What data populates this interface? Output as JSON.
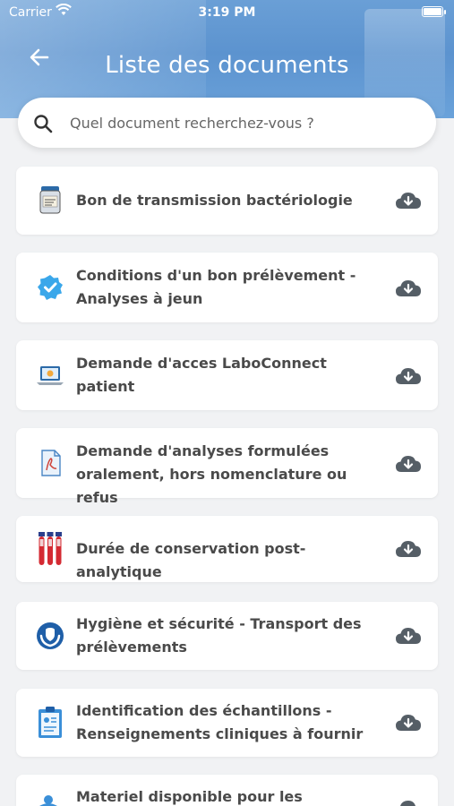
{
  "status": {
    "carrier": "Carrier",
    "time": "3:19 PM"
  },
  "header": {
    "title": "Liste des documents"
  },
  "search": {
    "placeholder": "Quel document recherchez-vous ?"
  },
  "documents": [
    {
      "title": "Bon de transmission bactériologie",
      "icon": "sample-jar-icon"
    },
    {
      "title": "Conditions d'un bon prélèvement - Analyses à jeun",
      "icon": "verified-badge-icon"
    },
    {
      "title": "Demande d'acces LaboConnect patient",
      "icon": "laptop-icon"
    },
    {
      "title": "Demande d'analyses formulées oralement, hors nomenclature ou refus",
      "icon": "pdf-document-icon"
    },
    {
      "title": "Durée de conservation post-analytique",
      "icon": "test-tubes-icon"
    },
    {
      "title": "Hygiène et sécurité  -  Transport des prélèvements",
      "icon": "hands-shield-icon"
    },
    {
      "title": "Identification des échantillons - Renseignements cliniques à fournir",
      "icon": "clipboard-icon"
    },
    {
      "title": "Materiel disponible pour les",
      "icon": "person-icon"
    }
  ],
  "colors": {
    "accent": "#5c93cf",
    "text": "#4a4a4a",
    "download_icon": "#555e66"
  }
}
